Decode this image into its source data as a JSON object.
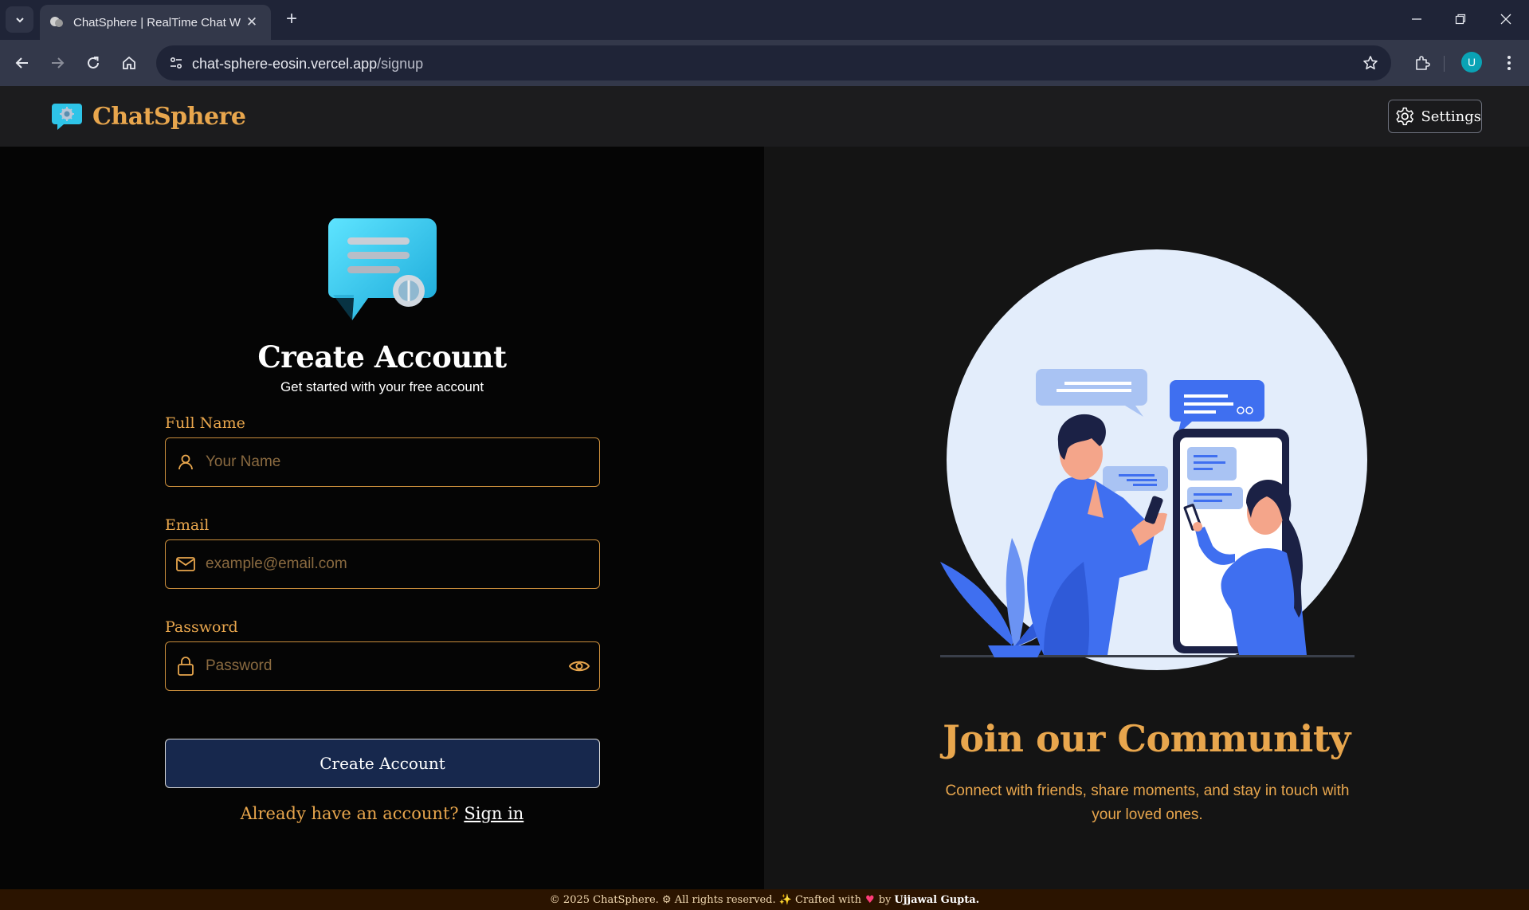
{
  "browser": {
    "tab_title": "ChatSphere | RealTime Chat Wi",
    "url_host": "chat-sphere-eosin.vercel.app",
    "url_path": "/signup",
    "profile_initial": "U"
  },
  "header": {
    "brand_name": "ChatSphere",
    "settings_label": "Settings"
  },
  "form": {
    "title": "Create Account",
    "subtitle": "Get started with your free account",
    "full_name_label": "Full Name",
    "full_name_placeholder": "Your Name",
    "full_name_value": "",
    "email_label": "Email",
    "email_placeholder": "example@email.com",
    "email_value": "",
    "password_label": "Password",
    "password_placeholder": "Password",
    "password_value": "",
    "submit_label": "Create Account",
    "signin_prompt": "Already have an account? ",
    "signin_link": "Sign in"
  },
  "promo": {
    "title": "Join our Community",
    "text": "Connect with friends, share moments, and stay in touch with your loved ones."
  },
  "footer": {
    "copyright": "© 2025 ChatSphere. ⚙ All rights reserved. ✨ Crafted with",
    "by": "by",
    "author": "Ujjawal Gupta."
  },
  "colors": {
    "accent": "#e8a64d",
    "button_bg": "#17284d",
    "footer_bg": "#2b1400"
  },
  "icons": [
    "tab-search-icon",
    "favicon-icon",
    "close-icon",
    "plus-icon",
    "minimize-icon",
    "restore-icon",
    "back-icon",
    "forward-icon",
    "reload-icon",
    "home-icon",
    "site-info-icon",
    "star-icon",
    "extensions-icon",
    "kebab-icon",
    "chat-logo-icon",
    "gear-icon",
    "user-icon",
    "mail-icon",
    "lock-icon",
    "eye-icon"
  ]
}
